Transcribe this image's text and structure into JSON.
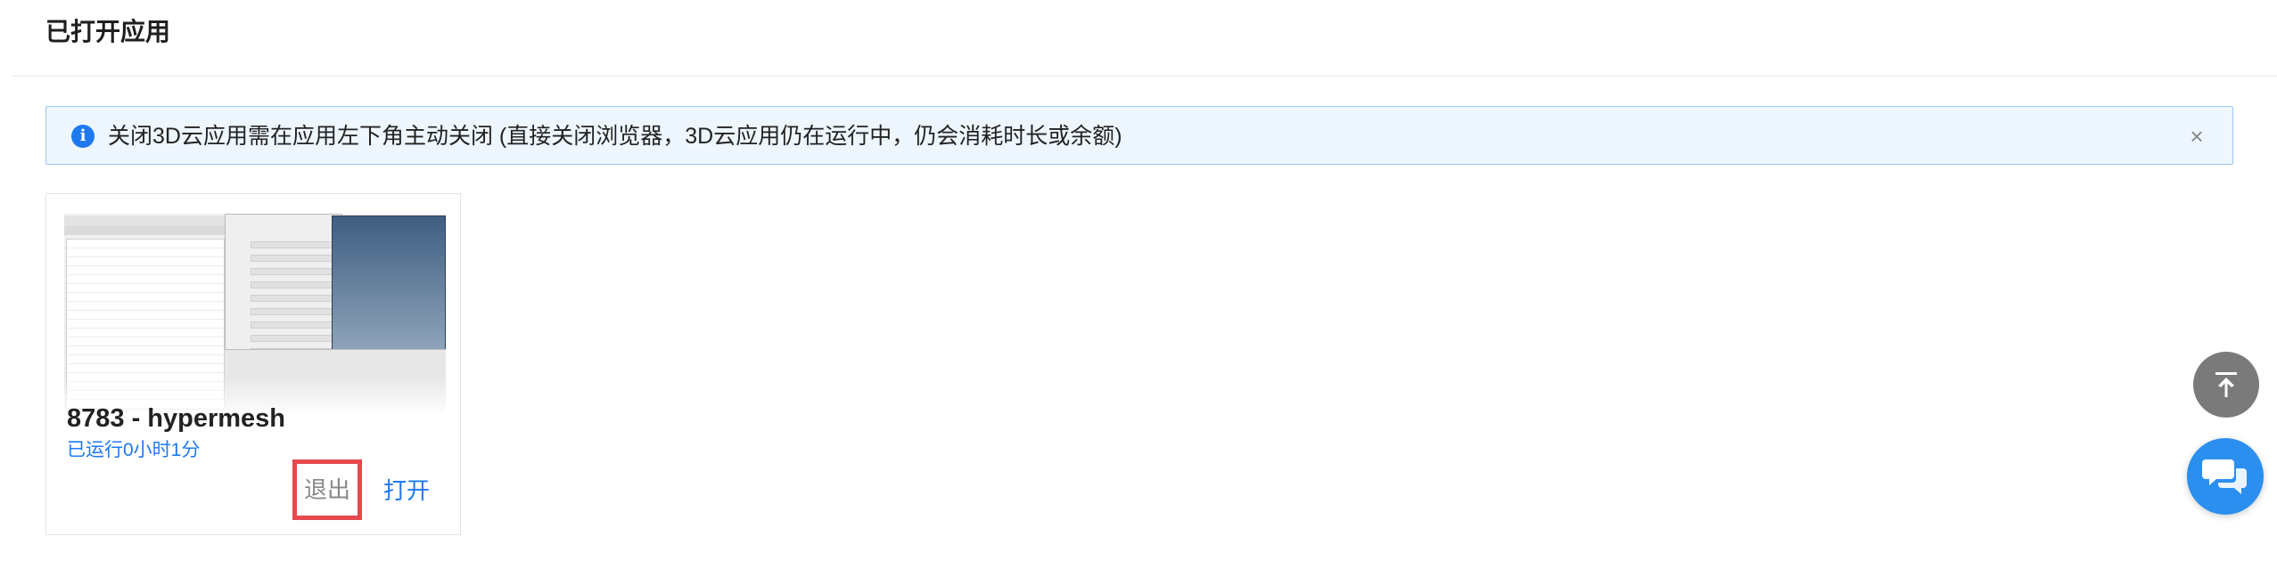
{
  "header": {
    "title": "已打开应用"
  },
  "notice": {
    "icon": "info-icon",
    "text": "关闭3D云应用需在应用左下角主动关闭 (直接关闭浏览器，3D云应用仍在运行中，仍会消耗时长或余额)",
    "close_icon": "close-icon",
    "close_glyph": "×"
  },
  "apps": [
    {
      "title": "8783 - hypermesh",
      "runtime": "已运行0小时1分",
      "exit_label": "退出",
      "open_label": "打开"
    }
  ],
  "floating": {
    "back_to_top_icon": "arrow-up-to-top-icon",
    "chat_icon": "chat-bubbles-icon"
  },
  "colors": {
    "accent": "#1e79ef",
    "notice_bg": "#eef6ff",
    "notice_border": "#9cc8f3",
    "highlight": "#e5484d"
  }
}
